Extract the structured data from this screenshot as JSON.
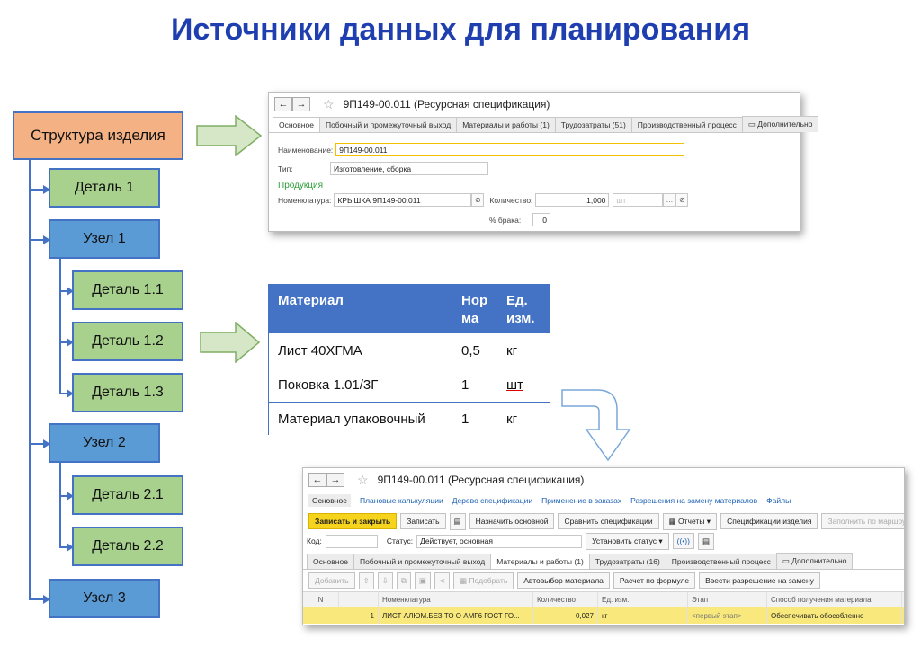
{
  "title": "Источники данных для планирования",
  "tree": {
    "root": "Структура изделия",
    "nodes": [
      {
        "label": "Деталь 1",
        "kind": "detail"
      },
      {
        "label": "Узел 1",
        "kind": "unit"
      },
      {
        "label": "Деталь 1.1",
        "kind": "detail"
      },
      {
        "label": "Деталь 1.2",
        "kind": "detail"
      },
      {
        "label": "Деталь 1.3",
        "kind": "detail"
      },
      {
        "label": "Узел 2",
        "kind": "unit"
      },
      {
        "label": "Деталь 2.1",
        "kind": "detail"
      },
      {
        "label": "Деталь 2.2",
        "kind": "detail"
      },
      {
        "label": "Узел 3",
        "kind": "unit"
      }
    ]
  },
  "spec_window_top": {
    "back": "←",
    "forward": "→",
    "title": "9П149-00.011 (Ресурсная спецификация)",
    "tabs": [
      "Основное",
      "Побочный и промежуточный выход",
      "Материалы и работы (1)",
      "Трудозатраты (51)",
      "Производственный процесс",
      "Дополнительно"
    ],
    "name_label": "Наименование:",
    "name_value": "9П149-00.011",
    "type_label": "Тип:",
    "type_value": "Изготовление, сборка",
    "section": "Продукция",
    "nomenclature_label": "Номенклатура:",
    "nomenclature_value": "КРЫШКА 9П149-00.011",
    "qty_label": "Количество:",
    "qty_value": "1,000",
    "unit_placeholder": "шт",
    "reject_label": "% брака:",
    "reject_value": "0"
  },
  "materials_table": {
    "headers": {
      "material": "Материал",
      "norm_1": "Нор",
      "norm_2": "ма",
      "unit_1": "Ед.",
      "unit_2": "изм."
    },
    "rows": [
      {
        "material": "Лист 40ХГМА",
        "norm": "0,5",
        "unit": "кг"
      },
      {
        "material": "Поковка 1.01/3Г",
        "norm": "1",
        "unit": "шт"
      },
      {
        "material": "Материал упаковочный",
        "norm": "1",
        "unit": "кг"
      }
    ]
  },
  "spec_window_bottom": {
    "back": "←",
    "forward": "→",
    "title": "9П149-00.011 (Ресурсная спецификация)",
    "nav_links": [
      "Основное",
      "Плановые калькуляции",
      "Дерево спецификации",
      "Применение в заказах",
      "Разрешения на замену материалов",
      "Файлы"
    ],
    "toolbar": {
      "save_close": "Записать и закрыть",
      "save": "Записать",
      "set_main": "Назначить основной",
      "compare": "Сравнить спецификации",
      "reports": "Отчеты",
      "product_specs": "Спецификации изделия",
      "fill_route": "Заполнить по маршрутным ка"
    },
    "code_label": "Код:",
    "status_label": "Статус:",
    "status_value": "Действует, основная",
    "set_status": "Установить статус",
    "tabs": [
      "Основное",
      "Побочный и промежуточный выход",
      "Материалы и работы (1)",
      "Трудозатраты (16)",
      "Производственный процесс",
      "Дополнительно"
    ],
    "grid_toolbar": {
      "add": "Добавить",
      "pick": "Подобрать",
      "autoselect": "Автовыбор материала",
      "formula": "Расчет по формуле",
      "replace": "Ввести разрешение на замену"
    },
    "columns": [
      "N",
      "Номенклатура",
      "Количество",
      "Ед. изм.",
      "Этап",
      "Способ получения материала"
    ],
    "rows": [
      {
        "n": "1",
        "nomenclature": "ЛИСТ АЛЮМ.БЕЗ ТО О АМГ6 ГОСТ ГО...",
        "qty": "0,027",
        "unit": "кг",
        "stage": "<первый этап>",
        "method": "Обеспечивать обособленно"
      }
    ]
  }
}
